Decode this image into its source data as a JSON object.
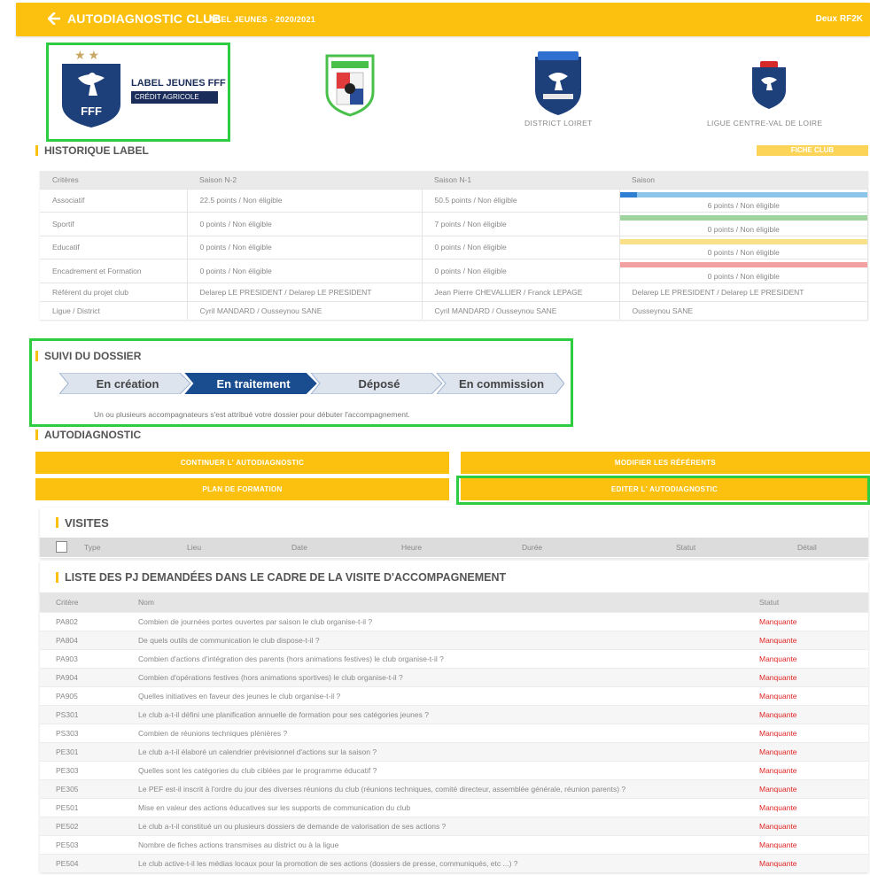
{
  "header": {
    "title": "AUTODIAGNOSTIC CLUB",
    "subtitle": "LABEL JEUNES - 2020/2021",
    "user": "Deux RF2K"
  },
  "logos": {
    "label_title": "LABEL JEUNES FFF",
    "label_partner": "CRÉDIT AGRICOLE",
    "fff_text": "FFF",
    "district_name": "DISTRICT LOIRET",
    "ligue_name": "LIGUE CENTRE-VAL DE LOIRE"
  },
  "historique": {
    "title": "HISTORIQUE LABEL",
    "fiche_button": "FICHE CLUB",
    "columns": [
      "Critères",
      "Saison N-2",
      "Saison N-1",
      "Saison"
    ],
    "rows": [
      {
        "critere": "Associatif",
        "n2": "22.5 points / Non éligible",
        "n1": "50.5 points / Non éligible",
        "saison": "6 points / Non éligible",
        "bar_color": "#8cc4ea",
        "bar_fill_color": "#2d7fd3",
        "bar_progress": 0.07
      },
      {
        "critere": "Sportif",
        "n2": "0 points / Non éligible",
        "n1": "7 points / Non éligible",
        "saison": "0 points / Non éligible",
        "bar_color": "#9fd49f",
        "bar_fill_color": "#3aa53a",
        "bar_progress": 0
      },
      {
        "critere": "Educatif",
        "n2": "0 points / Non éligible",
        "n1": "0 points / Non éligible",
        "saison": "0 points / Non éligible",
        "bar_color": "#fbe08a",
        "bar_fill_color": "#f5c518",
        "bar_progress": 0
      },
      {
        "critere": "Encadrement et Formation",
        "n2": "0 points / Non éligible",
        "n1": "0 points / Non éligible",
        "saison": "0 points / Non éligible",
        "bar_color": "#f2a0a0",
        "bar_fill_color": "#e05050",
        "bar_progress": 0
      }
    ],
    "referent_row": {
      "critere": "Référent du projet club",
      "n2": "Delarep LE PRESIDENT / Delarep LE PRESIDENT",
      "n1": "Jean Pierre CHEVALLIER / Franck LEPAGE",
      "saison": "Delarep LE PRESIDENT / Delarep LE PRESIDENT"
    },
    "ligue_row": {
      "critere": "Ligue / District",
      "n2": "Cyril MANDARD / Ousseynou SANE",
      "n1": "Cyril MANDARD / Ousseynou SANE",
      "saison": "Ousseynou SANE"
    }
  },
  "suivi": {
    "title": "SUIVI DU DOSSIER",
    "steps": [
      "En création",
      "En traitement",
      "Déposé",
      "En commission"
    ],
    "active_step": 1,
    "message": "Un ou plusieurs accompagnateurs s'est attribué votre dossier pour débuter l'accompagnement."
  },
  "autodiagnostic": {
    "title": "AUTODIAGNOSTIC",
    "buttons": {
      "continuer": "CONTINUER L' AUTODIAGNOSTIC",
      "modifier": "MODIFIER LES RÉFÉRENTS",
      "plan": "PLAN DE FORMATION",
      "editer": "EDITER L' AUTODIAGNOSTIC"
    }
  },
  "visites": {
    "title": "VISITES",
    "columns": [
      "Type",
      "Lieu",
      "Date",
      "Heure",
      "Durée",
      "Statut",
      "Détail"
    ]
  },
  "pj": {
    "title": "LISTE DES PJ DEMANDÉES DANS LE CADRE DE LA VISITE D'ACCOMPAGNEMENT",
    "columns": [
      "Critère",
      "Nom",
      "Statut"
    ],
    "rows": [
      {
        "code": "PA802",
        "nom": "Combien de journées portes ouvertes par saison le club organise-t-il ?",
        "statut": "Manquante"
      },
      {
        "code": "PA804",
        "nom": "De quels outils de communication le club dispose-t-il ?",
        "statut": "Manquante"
      },
      {
        "code": "PA903",
        "nom": "Combien d'actions d'intégration des parents (hors animations festives) le club organise-t-il ?",
        "statut": "Manquante"
      },
      {
        "code": "PA904",
        "nom": "Combien d'opérations festives (hors animations sportives) le club organise-t-il ?",
        "statut": "Manquante"
      },
      {
        "code": "PA905",
        "nom": "Quelles initiatives en faveur des jeunes le club organise-t-il ?",
        "statut": "Manquante"
      },
      {
        "code": "PS301",
        "nom": "Le club a-t-il défini une planification annuelle de formation pour ses catégories jeunes ?",
        "statut": "Manquante"
      },
      {
        "code": "PS303",
        "nom": "Combien de réunions techniques plénières ?",
        "statut": "Manquante"
      },
      {
        "code": "PE301",
        "nom": "Le club a-t-il élaboré un calendrier prévisionnel d'actions sur la saison ?",
        "statut": "Manquante"
      },
      {
        "code": "PE303",
        "nom": "Quelles sont les catégories du club ciblées par le programme éducatif ?",
        "statut": "Manquante"
      },
      {
        "code": "PE305",
        "nom": "Le PEF est-il inscrit à l'ordre du jour des diverses réunions du club (réunions techniques, comité directeur, assemblée générale, réunion parents) ?",
        "statut": "Manquante"
      },
      {
        "code": "PE501",
        "nom": "Mise en valeur des actions éducatives sur les supports de communication du club",
        "statut": "Manquante"
      },
      {
        "code": "PE502",
        "nom": "Le club a-t-il constitué un ou plusieurs dossiers de demande de valorisation de ses actions ?",
        "statut": "Manquante"
      },
      {
        "code": "PE503",
        "nom": "Nombre de fiches actions transmises au district ou à la ligue",
        "statut": "Manquante"
      },
      {
        "code": "PE504",
        "nom": "Le club active-t-il les médias locaux pour la promotion de ses actions (dossiers de presse, communiqués, etc ...) ?",
        "statut": "Manquante"
      }
    ]
  },
  "colors": {
    "accent": "#fcc10f",
    "highlight": "#2ecc40",
    "step_active": "#1a4d8f",
    "step_inactive": "#dde4ee",
    "status_missing": "#e02424"
  }
}
